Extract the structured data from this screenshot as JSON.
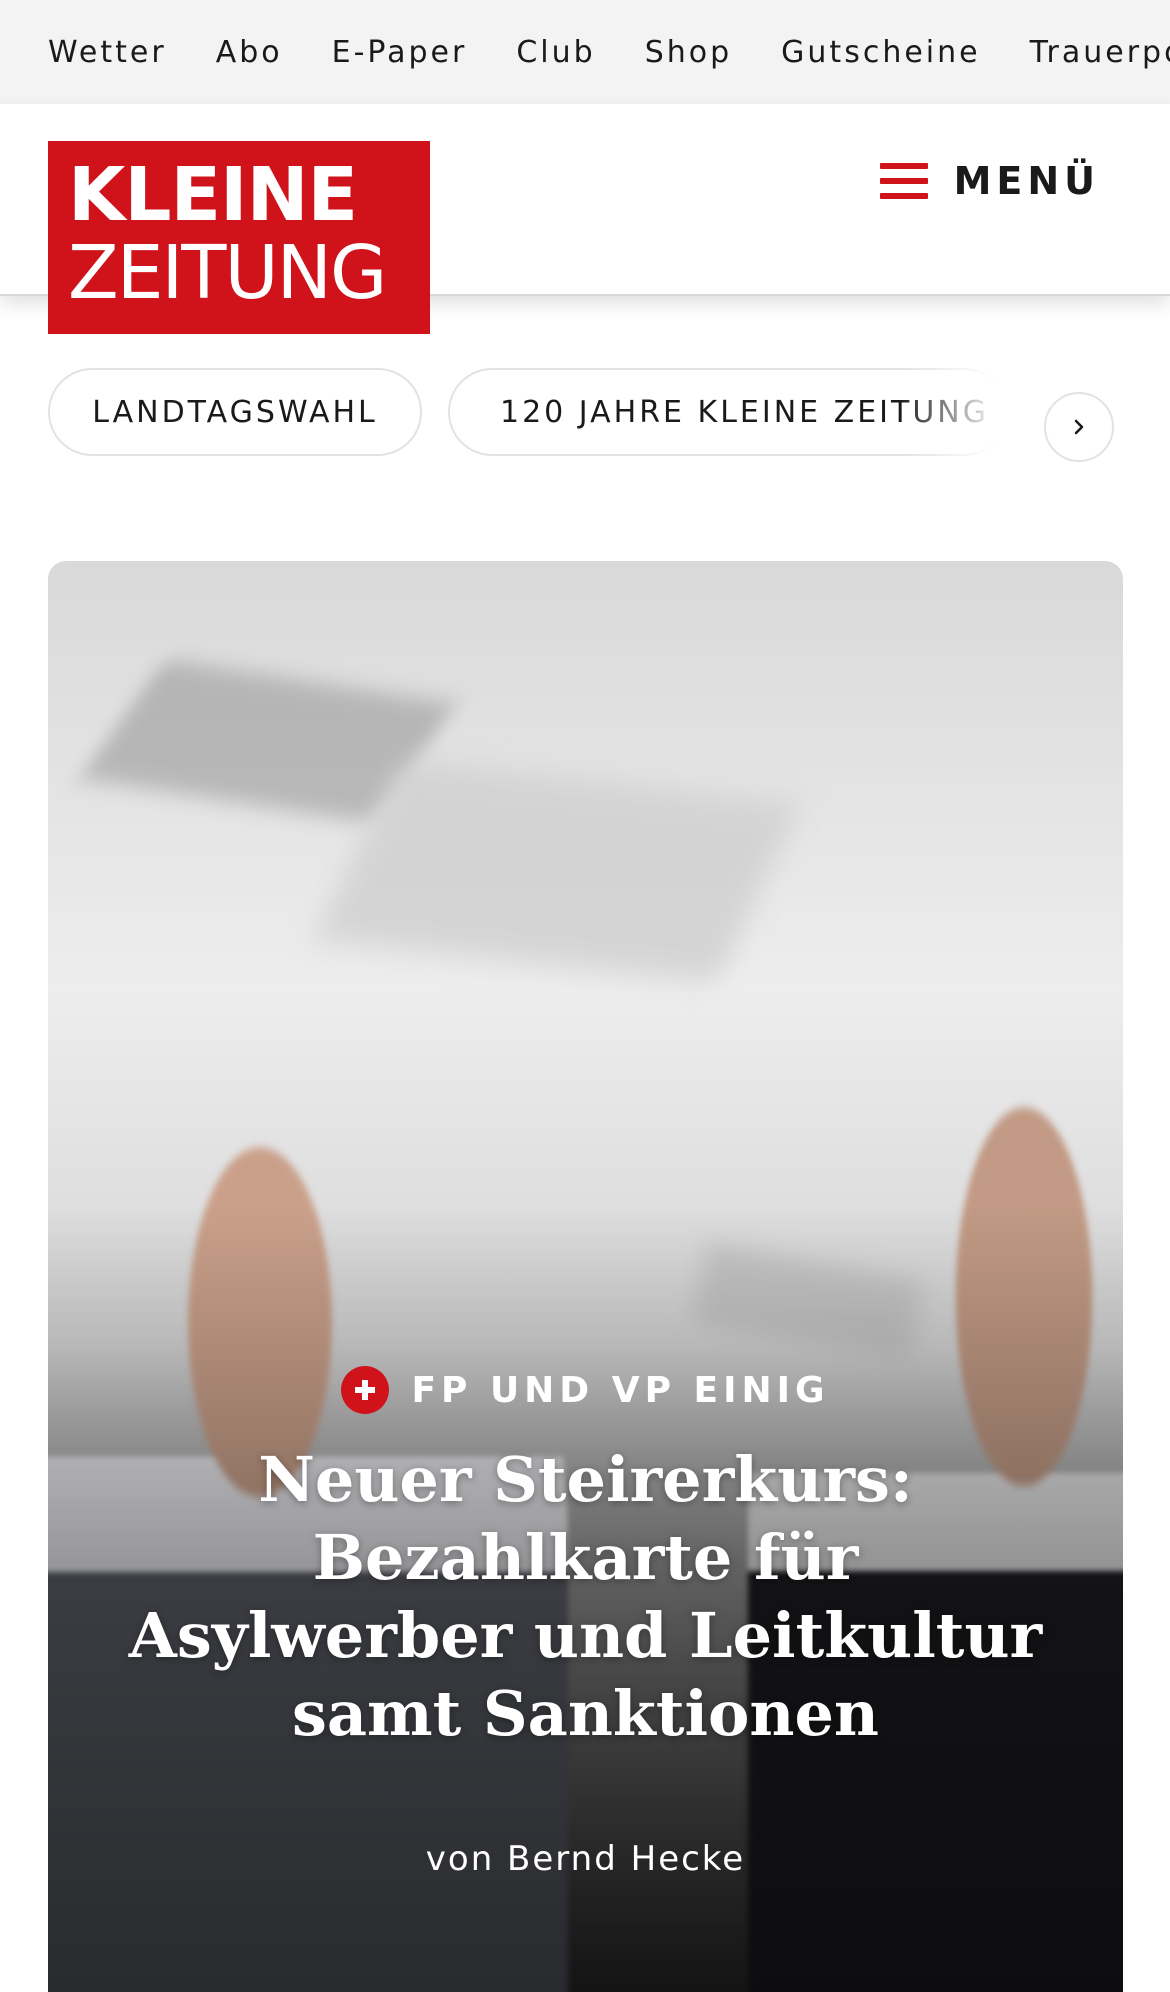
{
  "topnav": {
    "items": [
      {
        "label": "Wetter"
      },
      {
        "label": "Abo"
      },
      {
        "label": "E-Paper"
      },
      {
        "label": "Club"
      },
      {
        "label": "Shop"
      },
      {
        "label": "Gutscheine"
      },
      {
        "label": "Trauerpo"
      }
    ]
  },
  "header": {
    "logo": {
      "line1": "KLEINE",
      "line2": "ZEITUNG"
    },
    "menu_label": "MENÜ",
    "brand_color": "#d0121a"
  },
  "topics": {
    "items": [
      {
        "label": "LANDTAGSWAHL"
      },
      {
        "label": "120 JAHRE KLEINE ZEITUNG"
      }
    ],
    "next_icon": "chevron-right-icon"
  },
  "hero": {
    "kicker": "FP UND VP EINIG",
    "kicker_icon": "plus-icon",
    "headline": "Neuer Steirerkurs: Bezahlkarte für Asylwerber und Leitkultur samt Sanktionen",
    "byline": "von Bernd Hecke"
  }
}
